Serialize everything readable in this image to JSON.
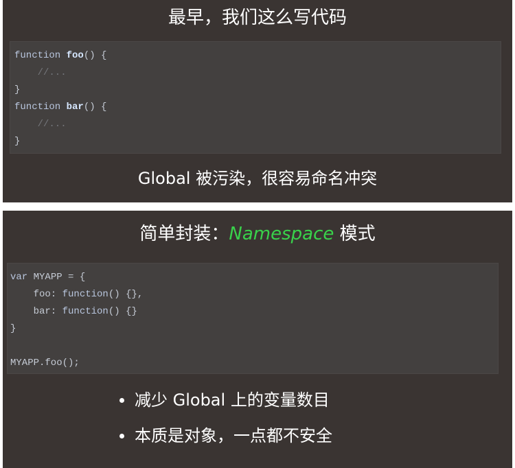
{
  "slide1": {
    "title": "最早，我们这么写代码",
    "code": {
      "line1": {
        "kw": "function",
        "fn": "foo",
        "rest": "() {"
      },
      "line2": {
        "comment": "    //..."
      },
      "line3": {
        "text": "}"
      },
      "line4": {
        "kw": "function",
        "fn": "bar",
        "rest": "() {"
      },
      "line5": {
        "comment": "    //..."
      },
      "line6": {
        "text": "}"
      }
    },
    "caption": "Global 被污染，很容易命名冲突"
  },
  "slide2": {
    "title_prefix": "简单封装：",
    "title_highlight": "Namespace",
    "title_suffix": " 模式",
    "code": {
      "line1": {
        "kw": "var",
        "rest": " MYAPP = {"
      },
      "line2": {
        "prop": "    foo: ",
        "kw": "function",
        "rest": "() {},"
      },
      "line3": {
        "prop": "    bar: ",
        "kw": "function",
        "rest": "() {}"
      },
      "line4": {
        "text": "}"
      },
      "line5": {
        "text": ""
      },
      "line6": {
        "text": "MYAPP.foo();"
      }
    },
    "bullets": [
      "减少 Global 上的变量数目",
      "本质是对象，一点都不安全"
    ]
  }
}
